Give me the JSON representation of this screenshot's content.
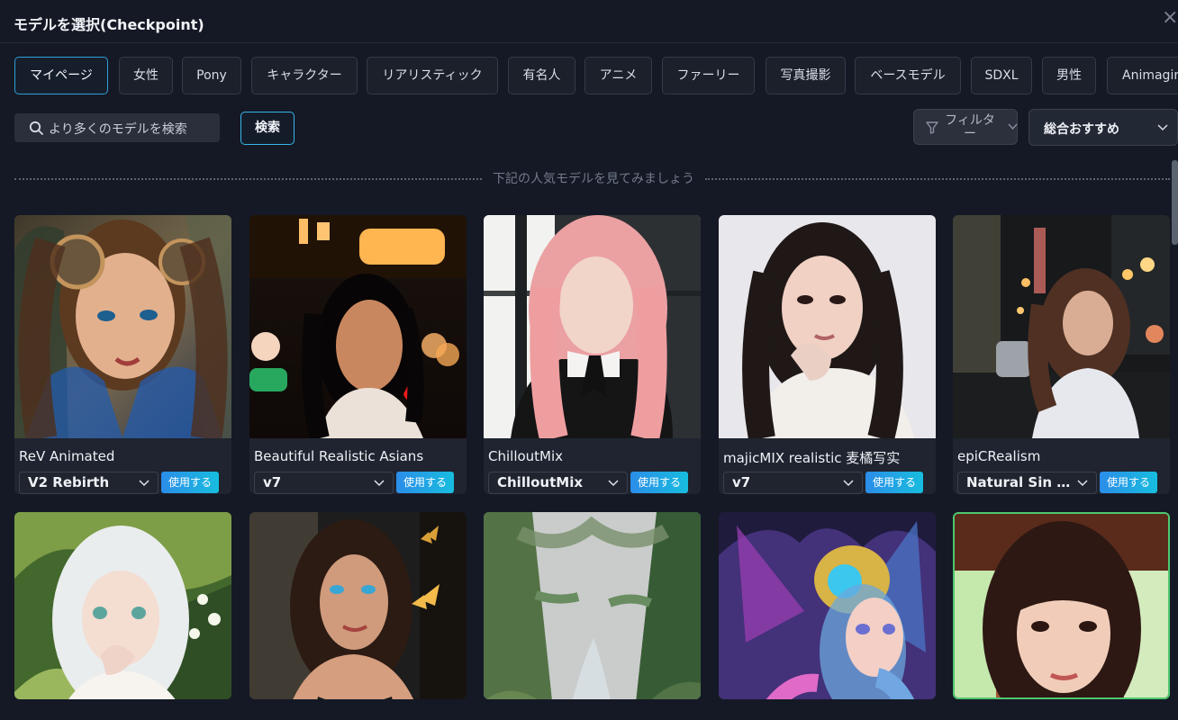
{
  "title": "モデルを選択(Checkpoint)",
  "close_icon": "close-icon",
  "categories": [
    "マイページ",
    "女性",
    "Pony",
    "キャラクター",
    "リアリスティック",
    "有名人",
    "アニメ",
    "ファーリー",
    "写真撮影",
    "ベースモデル",
    "SDXL",
    "男性",
    "Animagin"
  ],
  "active_category": "マイページ",
  "search": {
    "placeholder": "より多くのモデルを検索",
    "button": "検索"
  },
  "filter": {
    "label": "フィルター"
  },
  "sort": {
    "selected": "総合おすすめ"
  },
  "divider_text": "下記の人気モデルを見てみましょう",
  "use_button": "使用する",
  "models": [
    {
      "name": "ReV Animated",
      "version": "V2 Rebirth"
    },
    {
      "name": "Beautiful Realistic Asians",
      "version": "v7"
    },
    {
      "name": "ChilloutMix",
      "version": "ChilloutMix"
    },
    {
      "name": "majicMIX realistic 麦橘写实",
      "version": "v7"
    },
    {
      "name": "epiCRealism",
      "version": "Natural Sin R..."
    }
  ],
  "colors": {
    "background": "#151925",
    "card": "#1f2430",
    "accent": "#2e9ed6",
    "use_gradient": [
      "#2b8de9",
      "#17bddf"
    ],
    "selected_border": "#4ec86f"
  },
  "images": [
    "fantasy-portrait-robotic-headphones",
    "night-street-portrait",
    "pink-hair-school-uniform-portrait",
    "white-sweater-portrait",
    "city-night-portrait",
    "white-haired-anime-girl-plants",
    "butterfly-fantasy-portrait",
    "misty-jungle-stream",
    "colorful-feather-headdress",
    "bangs-portrait-green-frame"
  ]
}
